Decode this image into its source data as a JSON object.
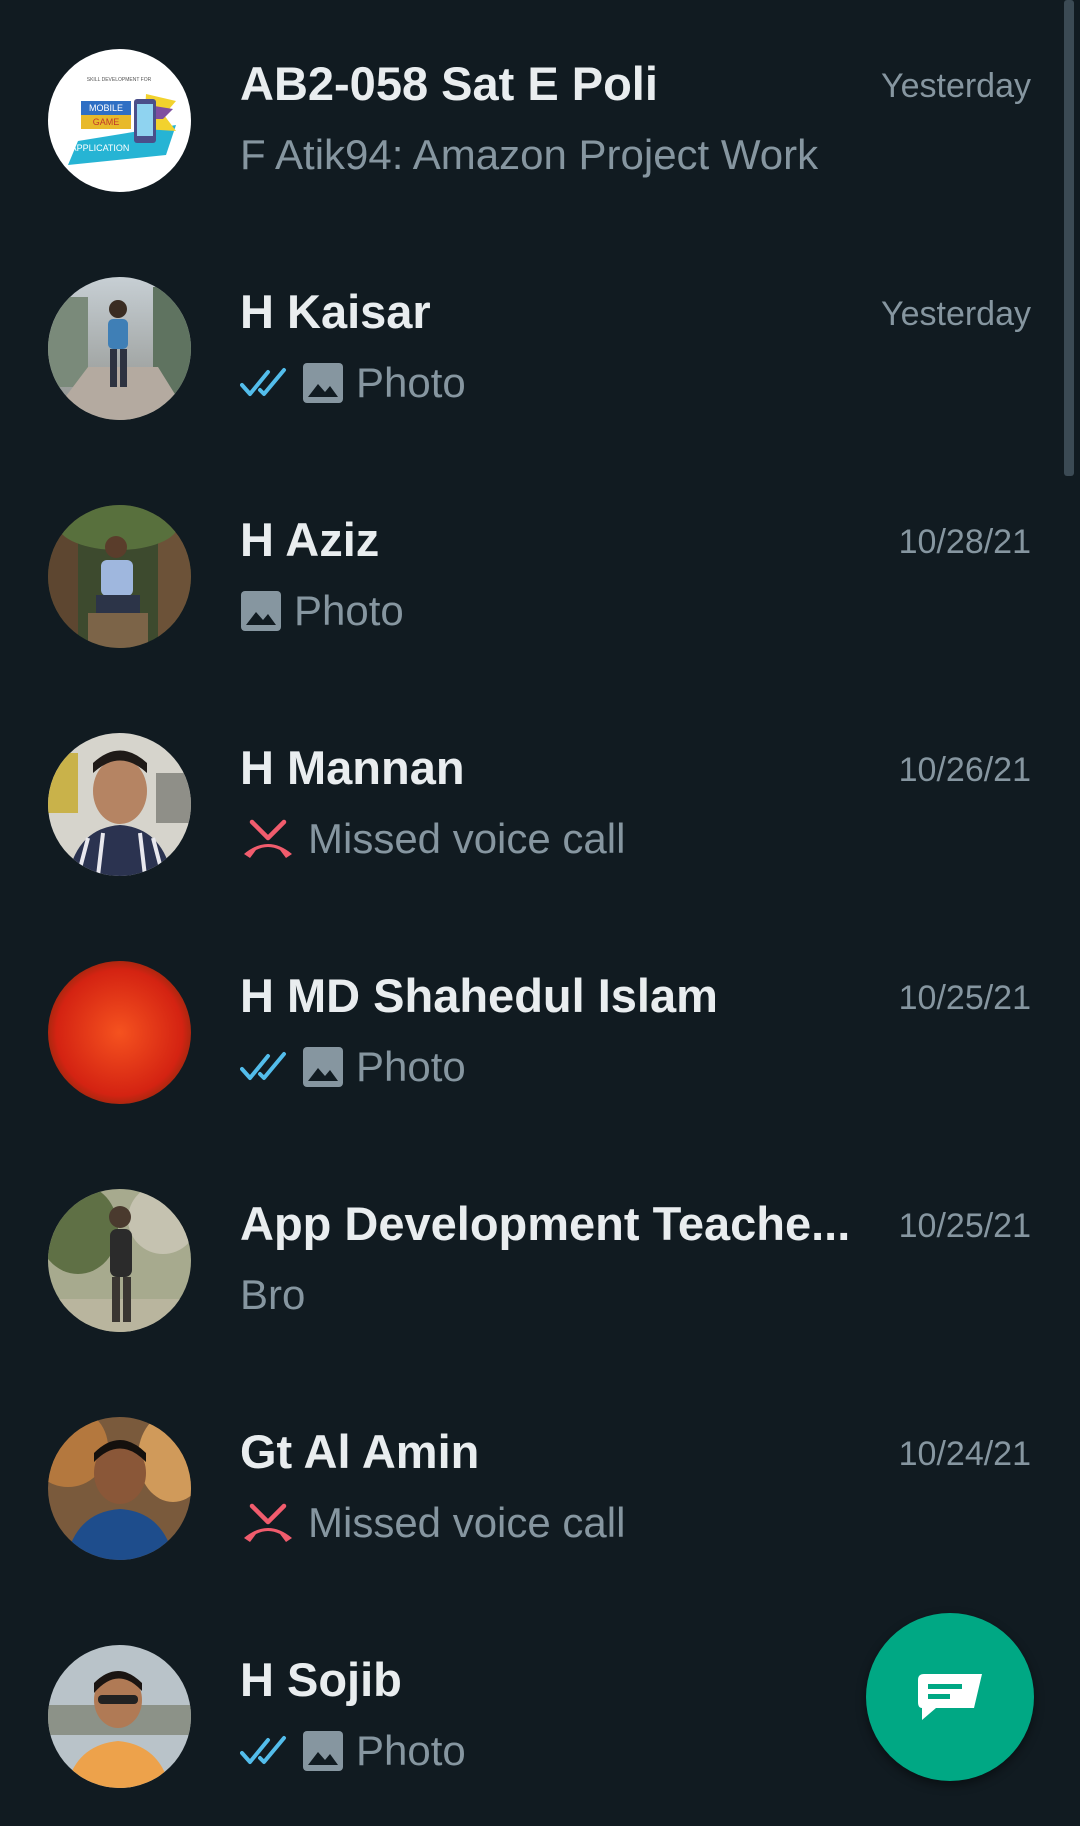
{
  "theme": {
    "background": "#111b21",
    "name_color": "#e9edef",
    "secondary_color": "#8696a0",
    "read_tick_color": "#53bdeb",
    "missed_call_color": "#f15c6d",
    "fab_color": "#00a884"
  },
  "chats": [
    {
      "name": "AB2-058 Sat E Poli",
      "time": "Yesterday",
      "preview": "F Atik94: Amazon Project Work",
      "status_icon": "none",
      "type_icon": "none"
    },
    {
      "name": "H Kaisar",
      "time": "Yesterday",
      "preview": "Photo",
      "status_icon": "double-check-icon",
      "type_icon": "photo-icon"
    },
    {
      "name": "H Aziz",
      "time": "10/28/21",
      "preview": "Photo",
      "status_icon": "none",
      "type_icon": "photo-icon"
    },
    {
      "name": "H Mannan",
      "time": "10/26/21",
      "preview": "Missed voice call",
      "status_icon": "none",
      "type_icon": "missed-call-icon"
    },
    {
      "name": "H MD Shahedul Islam",
      "time": "10/25/21",
      "preview": "Photo",
      "status_icon": "double-check-icon",
      "type_icon": "photo-icon"
    },
    {
      "name": "App Development Teache...",
      "time": "10/25/21",
      "preview": "Bro",
      "status_icon": "none",
      "type_icon": "none"
    },
    {
      "name": "Gt Al Amin",
      "time": "10/24/21",
      "preview": "Missed voice call",
      "status_icon": "none",
      "type_icon": "missed-call-icon"
    },
    {
      "name": "H Sojib",
      "time": "",
      "preview": "Photo",
      "status_icon": "double-check-icon",
      "type_icon": "photo-icon"
    }
  ],
  "avatar_logo": {
    "line1": "SKILL DEVELOPMENT FOR",
    "line2": "MOBILE",
    "line3": "GAME",
    "line4": "APPLICATION"
  },
  "fab": {
    "icon": "new-chat-icon"
  }
}
